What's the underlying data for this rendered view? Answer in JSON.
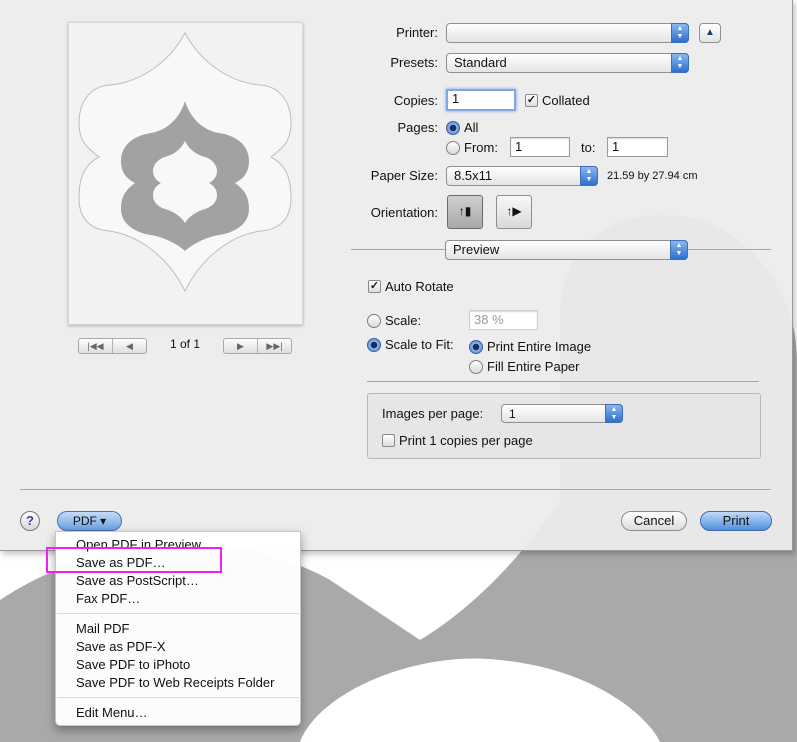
{
  "preview": {
    "page_indicator": "1 of 1",
    "nav_first_icon": "first-page-icon",
    "nav_prev_icon": "prev-page-icon",
    "nav_next_icon": "next-page-icon",
    "nav_last_icon": "last-page-icon"
  },
  "printer": {
    "label": "Printer:",
    "value": ""
  },
  "presets": {
    "label": "Presets:",
    "value": "Standard"
  },
  "copies": {
    "label": "Copies:",
    "value": "1",
    "collated_label": "Collated",
    "collated_checked": true
  },
  "pages": {
    "label": "Pages:",
    "all_label": "All",
    "from_label": "From:",
    "from_value": "1",
    "to_label": "to:",
    "to_value": "1",
    "selected": "All"
  },
  "paper_size": {
    "label": "Paper Size:",
    "value": "8.5x11",
    "dimensions": "21.59 by 27.94 cm"
  },
  "orientation": {
    "label": "Orientation:",
    "selected": "portrait"
  },
  "section_popup": {
    "value": "Preview"
  },
  "auto_rotate": {
    "label": "Auto Rotate",
    "checked": true
  },
  "scale": {
    "label": "Scale:",
    "value": "38 %"
  },
  "scale_to_fit": {
    "label": "Scale to Fit:",
    "print_entire_label": "Print Entire Image",
    "fill_entire_label": "Fill Entire Paper",
    "selected": "Print Entire Image"
  },
  "images_per_page": {
    "label": "Images per page:",
    "value": "1"
  },
  "print_copies": {
    "label": "Print 1 copies per page",
    "checked": false
  },
  "footer": {
    "help_label": "?",
    "pdf_label": "PDF ▾",
    "cancel_label": "Cancel",
    "print_label": "Print"
  },
  "pdf_menu": {
    "items": [
      "Open PDF in Preview",
      "Save as PDF…",
      "Save as PostScript…",
      "Fax PDF…",
      "Mail PDF",
      "Save as PDF-X",
      "Save PDF to iPhoto",
      "Save PDF to Web Receipts Folder",
      "Edit Menu…"
    ],
    "highlighted": "Save as PDF…"
  },
  "colors": {
    "accent": "#3b79d6",
    "highlight_box": "#ee22ee",
    "background_shape": "#a9a9a9"
  }
}
